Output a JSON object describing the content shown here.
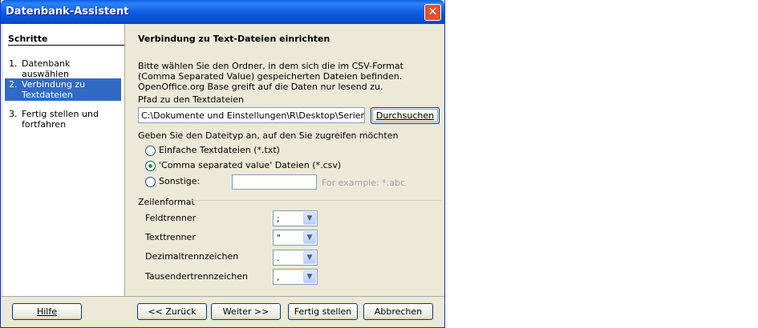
{
  "window": {
    "title": "Datenbank-Assistent",
    "close_symbol": "✕"
  },
  "steps": {
    "heading": "Schritte",
    "items": [
      {
        "num": "1.",
        "label": "Datenbank auswählen"
      },
      {
        "num": "2.",
        "label": "Verbindung zu Textdateien einrichten"
      },
      {
        "num": "3.",
        "label": "Fertig stellen und fortfahren"
      }
    ]
  },
  "main": {
    "heading": "Verbindung zu Text-Dateien einrichten",
    "description": "Bitte wählen Sie den Ordner, in dem sich die im CSV-Format (Comma Separated Value) gespeicherten Dateien befinden. OpenOffice.org Base greift auf die Daten nur lesend zu.",
    "path_label": "Pfad zu den Textdateien",
    "path_value": "C:\\Dokumente und Einstellungen\\R\\Desktop\\Serienbrief Re",
    "browse_label": "Durchsuchen",
    "filetype_label": "Geben Sie den Dateityp an, auf den Sie zugreifen möchten",
    "filetypes": [
      {
        "label": "Einfache Textdateien (*.txt)",
        "selected": false
      },
      {
        "label": "'Comma separated value' Dateien (*.csv)",
        "selected": true
      },
      {
        "label": "Sonstige:",
        "selected": false
      }
    ],
    "other_placeholder": "For example: *.abc",
    "row_format_label": "Zeilenformat",
    "fields": [
      {
        "label": "Feldtrenner",
        "value": ";"
      },
      {
        "label": "Texttrenner",
        "value": "\""
      },
      {
        "label": "Dezimaltrennzeichen",
        "value": "."
      },
      {
        "label": "Tausendertrennzeichen",
        "value": ","
      }
    ]
  },
  "footer": {
    "help": "Hilfe",
    "back": "<< Zurück",
    "next": "Weiter >>",
    "finish": "Fertig stellen",
    "cancel": "Abbrechen"
  }
}
